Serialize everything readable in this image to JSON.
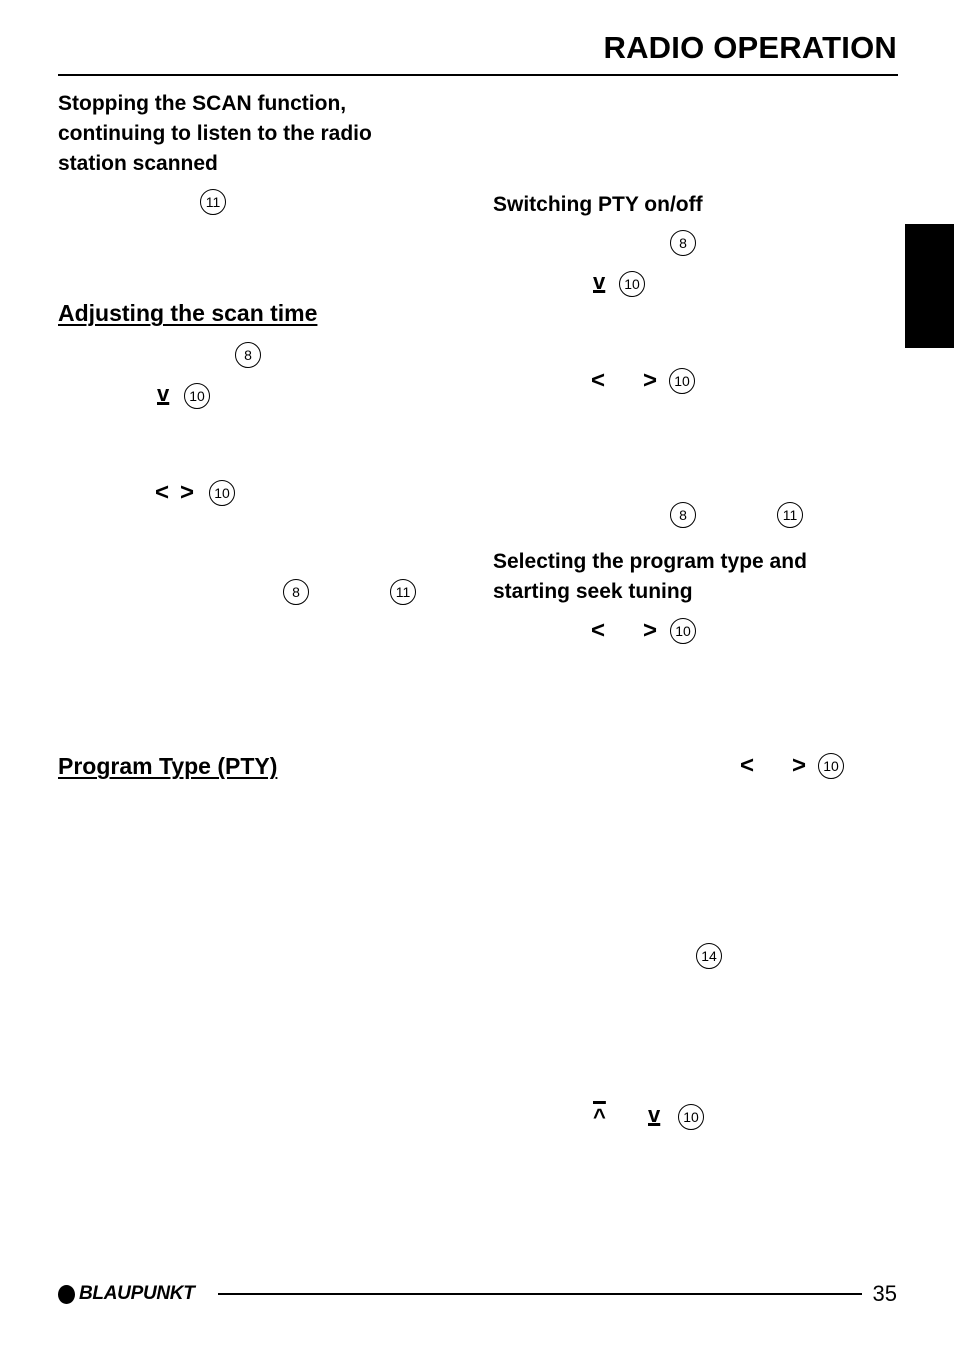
{
  "header": {
    "title": "RADIO OPERATION"
  },
  "left": {
    "stop_scan_heading": [
      "Stopping the SCAN function,",
      "continuing to listen to the radio",
      "station scanned"
    ],
    "stop_scan_ref": "11",
    "scan_time_heading": "Adjusting the scan time",
    "scan_time_refs": {
      "menu": "8",
      "down": "10",
      "left_right": "10",
      "confirm_a": "8",
      "confirm_b": "11"
    },
    "pty_heading": "Program Type (PTY)"
  },
  "right": {
    "pty_onoff_heading": "Switching PTY on/off",
    "pty_onoff_refs": {
      "menu": "8",
      "down": "10",
      "left_right": "10",
      "confirm_a": "8",
      "confirm_b": "11"
    },
    "select_heading": [
      "Selecting the program type and",
      "starting seek tuning"
    ],
    "select_refs": {
      "left_right": "10",
      "left_right_2": "10",
      "prog": "14",
      "up_down": "10"
    }
  },
  "symbols": {
    "left": "<",
    "right": ">",
    "down": "v",
    "up": "^"
  },
  "footer": {
    "brand": "BLAUPUNKT",
    "page_number": "35"
  }
}
